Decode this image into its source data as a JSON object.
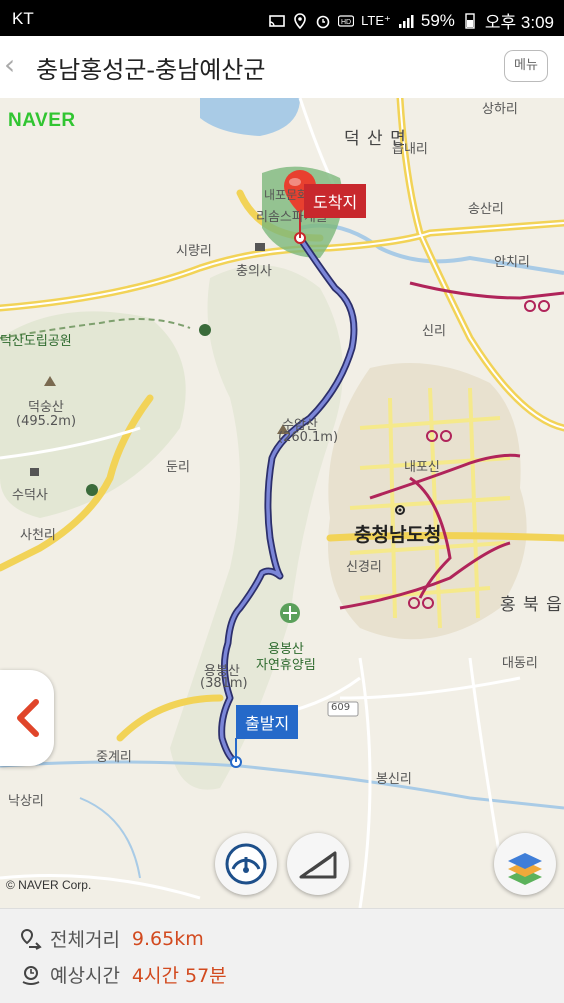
{
  "status_bar": {
    "carrier": "KT",
    "network": "LTE⁺",
    "battery": "59%",
    "time": "오후 3:09"
  },
  "header": {
    "back_icon": "‹",
    "title": "충남홍성군-충남예산군",
    "menu_label": "메뉴"
  },
  "map": {
    "logo": "NAVER",
    "copyright": "© NAVER Corp.",
    "labels": {
      "deoksan_myeon": "덕 산 면",
      "eumnaeri": "읍내리",
      "sanghari": "상하리",
      "songsanri": "송산리",
      "anchiri": "안치리",
      "siryangri": "시량리",
      "chunguisa": "충의사",
      "sinri": "신리",
      "provincial_park": "덕산도립공원",
      "deoksan_peak": "덕숭산",
      "deoksan_elev": "(495.2m)",
      "sudeoksa": "수덕사",
      "dunri": "둔리",
      "suamsan": "수암산",
      "suamsan_elev": "(260.1m)",
      "naepo": "내포신",
      "sacheonri": "사천리",
      "provincial_office": "충청남도청",
      "singyeongri": "신경리",
      "hongbuk": "홍 북 읍",
      "yongbongsan_forest": "용봉산",
      "yongbongsan_forest2": "자연휴양림",
      "yongbongsan_peak": "용봉산",
      "yongbongsan_elev": "(381m)",
      "daedongri": "대동리",
      "route_609": "609",
      "junggyeri": "중계리",
      "naksangri": "낙상리",
      "bongsinri": "봉신리",
      "resort": "리솜스파캐슬",
      "naepo_resort": "내포문화"
    },
    "destination_label": "도착지",
    "start_label": "출발지",
    "colors": {
      "route": "#5a62b8",
      "destination": "#c8282d",
      "start": "#2569c9",
      "bike_path": "#b0245a"
    }
  },
  "info": {
    "distance_label": "전체거리",
    "distance_value": "9.65km",
    "time_label": "예상시간",
    "time_value": "4시간 57분",
    "value_color": "#d24a1f"
  }
}
